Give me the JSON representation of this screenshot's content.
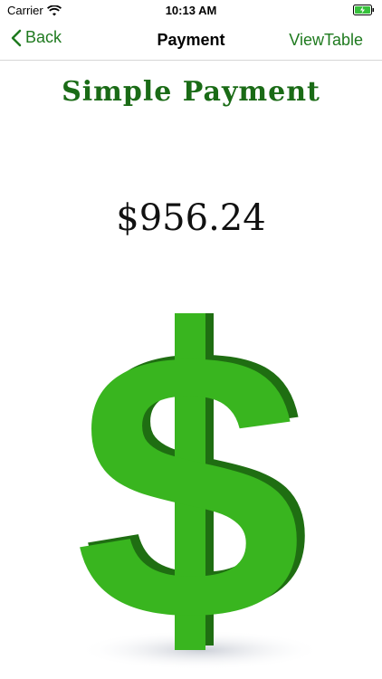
{
  "status_bar": {
    "carrier": "Carrier",
    "time": "10:13 AM",
    "icons": [
      "wifi-icon",
      "battery-charging-icon"
    ]
  },
  "nav": {
    "back_label": "Back",
    "title": "Payment",
    "right_label": "ViewTable"
  },
  "main": {
    "heading": "Simple Payment",
    "amount": "$956.24",
    "illustration": "green-dollar-sign-icon"
  },
  "colors": {
    "accent": "#1f7a1f",
    "heading": "#1a6b16",
    "dollar_green": "#39b51f",
    "dollar_shadow": "#1f6e12"
  }
}
